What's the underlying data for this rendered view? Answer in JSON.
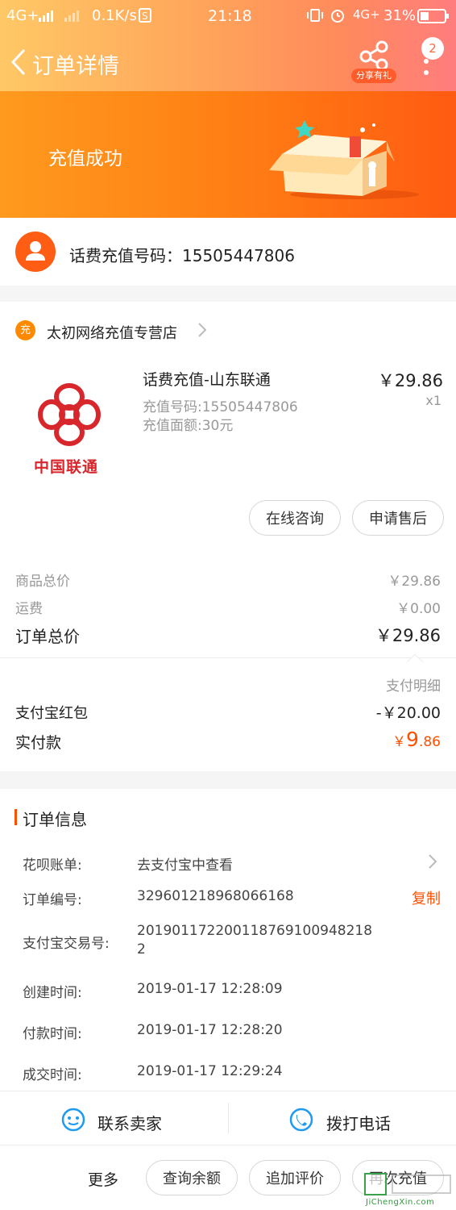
{
  "status_bar": {
    "network": "4G+",
    "speed": "0.1K/s",
    "time": "21:18",
    "network2": "4G+",
    "battery": "31%"
  },
  "nav": {
    "title": "订单详情",
    "share_label": "分享有礼",
    "badge_count": "2"
  },
  "banner": {
    "status_text": "充值成功"
  },
  "recipient": {
    "label": "话费充值号码：15505447806"
  },
  "shop": {
    "badge": "充",
    "name": "太初网络充值专营店"
  },
  "product": {
    "logo_text": "中国联通",
    "title": "话费充值-山东联通",
    "line1": "充值号码:15505447806",
    "line2": "充值面额:30元",
    "price": "￥29.86",
    "qty": "x1",
    "btn_consult": "在线咨询",
    "btn_aftersale": "申请售后"
  },
  "price_summary": {
    "goods_label": "商品总价",
    "goods_value": "￥29.86",
    "shipping_label": "运费",
    "shipping_value": "￥0.00",
    "total_label": "订单总价",
    "total_value": "￥29.86",
    "pay_detail": "支付明细",
    "redpacket_label": "支付宝红包",
    "redpacket_value": "-￥20.00",
    "paid_label": "实付款",
    "paid_currency": "￥",
    "paid_int": "9",
    "paid_dec": ".86"
  },
  "order_info": {
    "section_title": "订单信息",
    "huabei_label": "花呗账单:",
    "huabei_value": "去支付宝中查看",
    "order_no_label": "订单编号:",
    "order_no_value": "329601218968066168",
    "copy_label": "复制",
    "alipay_no_label": "支付宝交易号:",
    "alipay_no_line1": "20190117220011876910094821​8",
    "alipay_no_line2": "2",
    "created_label": "创建时间:",
    "created_value": "2019-01-17 12:28:09",
    "paid_time_label": "付款时间:",
    "paid_time_value": "2019-01-17 12:28:20",
    "deal_time_label": "成交时间:",
    "deal_time_value": "2019-01-17 12:29:24"
  },
  "contact": {
    "seller": "联系卖家",
    "phone": "拨打电话"
  },
  "bottom_bar": {
    "more": "更多",
    "btn_balance": "查询余额",
    "btn_review": "追加评价",
    "btn_recharge": "再次充值"
  },
  "watermark": {
    "text": "JiChengXin.com"
  },
  "colors": {
    "accent": "#ff5000",
    "banner_start": "#ff9a1e",
    "banner_end": "#ff5b12"
  }
}
